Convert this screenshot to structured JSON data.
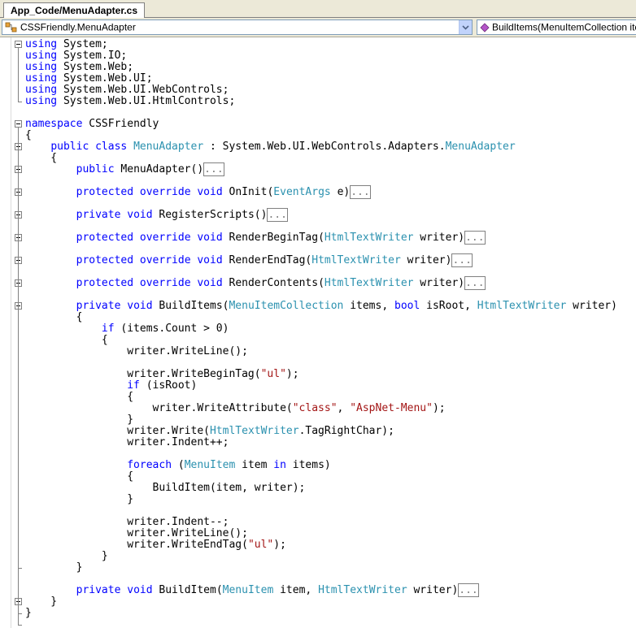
{
  "tab": {
    "title": "App_Code/MenuAdapter.cs"
  },
  "nav": {
    "type_combo": "CSSFriendly.MenuAdapter",
    "member_combo": "BuildItems(MenuItemCollection items"
  },
  "editor": {
    "lines": [
      [
        [
          "kw",
          "using"
        ],
        [
          "t",
          " System;"
        ]
      ],
      [
        [
          "kw",
          "using"
        ],
        [
          "t",
          " System.IO;"
        ]
      ],
      [
        [
          "kw",
          "using"
        ],
        [
          "t",
          " System.Web;"
        ]
      ],
      [
        [
          "kw",
          "using"
        ],
        [
          "t",
          " System.Web.UI;"
        ]
      ],
      [
        [
          "kw",
          "using"
        ],
        [
          "t",
          " System.Web.UI.WebControls;"
        ]
      ],
      [
        [
          "kw",
          "using"
        ],
        [
          "t",
          " System.Web.UI.HtmlControls;"
        ]
      ],
      [],
      [
        [
          "kw",
          "namespace"
        ],
        [
          "t",
          " CSSFriendly"
        ]
      ],
      [
        [
          "t",
          "{"
        ]
      ],
      [
        [
          "t",
          "    "
        ],
        [
          "kw",
          "public"
        ],
        [
          "t",
          " "
        ],
        [
          "kw",
          "class"
        ],
        [
          "t",
          " "
        ],
        [
          "ty",
          "MenuAdapter"
        ],
        [
          "t",
          " : System.Web.UI.WebControls.Adapters."
        ],
        [
          "ty",
          "MenuAdapter"
        ]
      ],
      [
        [
          "t",
          "    {"
        ]
      ],
      [
        [
          "t",
          "        "
        ],
        [
          "kw",
          "public"
        ],
        [
          "t",
          " MenuAdapter()"
        ],
        [
          "col",
          "..."
        ]
      ],
      [],
      [
        [
          "t",
          "        "
        ],
        [
          "kw",
          "protected"
        ],
        [
          "t",
          " "
        ],
        [
          "kw",
          "override"
        ],
        [
          "t",
          " "
        ],
        [
          "kw",
          "void"
        ],
        [
          "t",
          " OnInit("
        ],
        [
          "ty",
          "EventArgs"
        ],
        [
          "t",
          " e)"
        ],
        [
          "col",
          "..."
        ]
      ],
      [],
      [
        [
          "t",
          "        "
        ],
        [
          "kw",
          "private"
        ],
        [
          "t",
          " "
        ],
        [
          "kw",
          "void"
        ],
        [
          "t",
          " RegisterScripts()"
        ],
        [
          "col",
          "..."
        ]
      ],
      [],
      [
        [
          "t",
          "        "
        ],
        [
          "kw",
          "protected"
        ],
        [
          "t",
          " "
        ],
        [
          "kw",
          "override"
        ],
        [
          "t",
          " "
        ],
        [
          "kw",
          "void"
        ],
        [
          "t",
          " RenderBeginTag("
        ],
        [
          "ty",
          "HtmlTextWriter"
        ],
        [
          "t",
          " writer)"
        ],
        [
          "col",
          "..."
        ]
      ],
      [],
      [
        [
          "t",
          "        "
        ],
        [
          "kw",
          "protected"
        ],
        [
          "t",
          " "
        ],
        [
          "kw",
          "override"
        ],
        [
          "t",
          " "
        ],
        [
          "kw",
          "void"
        ],
        [
          "t",
          " RenderEndTag("
        ],
        [
          "ty",
          "HtmlTextWriter"
        ],
        [
          "t",
          " writer)"
        ],
        [
          "col",
          "..."
        ]
      ],
      [],
      [
        [
          "t",
          "        "
        ],
        [
          "kw",
          "protected"
        ],
        [
          "t",
          " "
        ],
        [
          "kw",
          "override"
        ],
        [
          "t",
          " "
        ],
        [
          "kw",
          "void"
        ],
        [
          "t",
          " RenderContents("
        ],
        [
          "ty",
          "HtmlTextWriter"
        ],
        [
          "t",
          " writer)"
        ],
        [
          "col",
          "..."
        ]
      ],
      [],
      [
        [
          "t",
          "        "
        ],
        [
          "kw",
          "private"
        ],
        [
          "t",
          " "
        ],
        [
          "kw",
          "void"
        ],
        [
          "t",
          " BuildItems("
        ],
        [
          "ty",
          "MenuItemCollection"
        ],
        [
          "t",
          " items, "
        ],
        [
          "kw",
          "bool"
        ],
        [
          "t",
          " isRoot, "
        ],
        [
          "ty",
          "HtmlTextWriter"
        ],
        [
          "t",
          " writer)"
        ]
      ],
      [
        [
          "t",
          "        {"
        ]
      ],
      [
        [
          "t",
          "            "
        ],
        [
          "kw",
          "if"
        ],
        [
          "t",
          " (items.Count > 0)"
        ]
      ],
      [
        [
          "t",
          "            {"
        ]
      ],
      [
        [
          "t",
          "                writer.WriteLine();"
        ]
      ],
      [],
      [
        [
          "t",
          "                writer.WriteBeginTag("
        ],
        [
          "str",
          "\"ul\""
        ],
        [
          "t",
          ");"
        ]
      ],
      [
        [
          "t",
          "                "
        ],
        [
          "kw",
          "if"
        ],
        [
          "t",
          " (isRoot)"
        ]
      ],
      [
        [
          "t",
          "                {"
        ]
      ],
      [
        [
          "t",
          "                    writer.WriteAttribute("
        ],
        [
          "str",
          "\"class\""
        ],
        [
          "t",
          ", "
        ],
        [
          "str",
          "\"AspNet-Menu\""
        ],
        [
          "t",
          ");"
        ]
      ],
      [
        [
          "t",
          "                }"
        ]
      ],
      [
        [
          "t",
          "                writer.Write("
        ],
        [
          "ty",
          "HtmlTextWriter"
        ],
        [
          "t",
          ".TagRightChar);"
        ]
      ],
      [
        [
          "t",
          "                writer.Indent++;"
        ]
      ],
      [],
      [
        [
          "t",
          "                "
        ],
        [
          "kw",
          "foreach"
        ],
        [
          "t",
          " ("
        ],
        [
          "ty",
          "MenuItem"
        ],
        [
          "t",
          " item "
        ],
        [
          "kw",
          "in"
        ],
        [
          "t",
          " items)"
        ]
      ],
      [
        [
          "t",
          "                {"
        ]
      ],
      [
        [
          "t",
          "                    BuildItem(item, writer);"
        ]
      ],
      [
        [
          "t",
          "                }"
        ]
      ],
      [],
      [
        [
          "t",
          "                writer.Indent--;"
        ]
      ],
      [
        [
          "t",
          "                writer.WriteLine();"
        ]
      ],
      [
        [
          "t",
          "                writer.WriteEndTag("
        ],
        [
          "str",
          "\"ul\""
        ],
        [
          "t",
          ");"
        ]
      ],
      [
        [
          "t",
          "            }"
        ]
      ],
      [
        [
          "t",
          "        }"
        ]
      ],
      [],
      [
        [
          "t",
          "        "
        ],
        [
          "kw",
          "private"
        ],
        [
          "t",
          " "
        ],
        [
          "kw",
          "void"
        ],
        [
          "t",
          " BuildItem("
        ],
        [
          "ty",
          "MenuItem"
        ],
        [
          "t",
          " item, "
        ],
        [
          "ty",
          "HtmlTextWriter"
        ],
        [
          "t",
          " writer)"
        ],
        [
          "col",
          "..."
        ]
      ],
      [
        [
          "t",
          "    }"
        ]
      ],
      [
        [
          "t",
          "}"
        ]
      ]
    ]
  }
}
